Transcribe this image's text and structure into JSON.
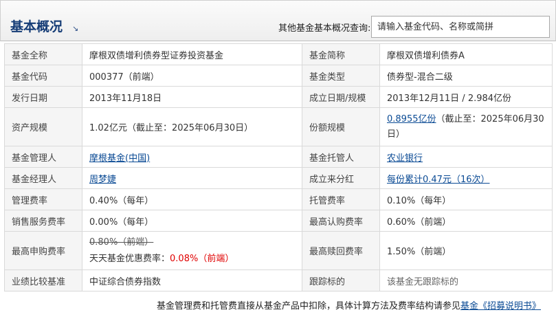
{
  "header": {
    "title": "基本概况",
    "title_arrow": "↘",
    "search_label": "其他基金基本概况查询:",
    "search_placeholder": "请输入基金代码、名称或简拼"
  },
  "rows": {
    "fullname_label": "基金全称",
    "fullname_value": "摩根双债增利债券型证券投资基金",
    "shortname_label": "基金简称",
    "shortname_value": "摩根双债增利债券A",
    "code_label": "基金代码",
    "code_value": "000377（前端）",
    "type_label": "基金类型",
    "type_value": "债券型-混合二级",
    "issue_label": "发行日期",
    "issue_value": "2013年11月18日",
    "established_label": "成立日期/规模",
    "established_value": "2013年12月11日 / 2.984亿份",
    "asset_label": "资产规模",
    "asset_value": "1.02亿元（截止至：2025年06月30日）",
    "share_label": "份额规模",
    "share_link": "0.8955亿份",
    "share_rest": "（截止至：2025年06月30日）",
    "manager_label": "基金管理人",
    "manager_link": "摩根基金(中国)",
    "custodian_label": "基金托管人",
    "custodian_link": "农业银行",
    "fundmgr_label": "基金经理人",
    "fundmgr_link": "周梦婕",
    "dividend_label": "成立来分红",
    "dividend_link": "每份累计0.47元（16次）",
    "mgmt_fee_label": "管理费率",
    "mgmt_fee_value": "0.40%（每年）",
    "custody_fee_label": "托管费率",
    "custody_fee_value": "0.10%（每年）",
    "sales_fee_label": "销售服务费率",
    "sales_fee_value": "0.00%（每年）",
    "max_subscribe_label": "最高认购费率",
    "max_subscribe_value": "0.60%（前端）",
    "max_purchase_label": "最高申购费率",
    "max_purchase_orig": "0.80%（前端）",
    "max_purchase_promo_label": "天天基金优惠费率：",
    "max_purchase_promo_value": "0.08%（前端）",
    "max_redeem_label": "最高赎回费率",
    "max_redeem_value": "1.50%（前端）",
    "benchmark_label": "业绩比较基准",
    "benchmark_value": "中证综合债券指数",
    "tracking_label": "跟踪标的",
    "tracking_value": "该基金无跟踪标的"
  },
  "footer": {
    "note_text": "基金管理费和托管费直接从基金产品中扣除，具体计算方法及费率结构请参见",
    "note_link": "基金《招募说明书》"
  }
}
